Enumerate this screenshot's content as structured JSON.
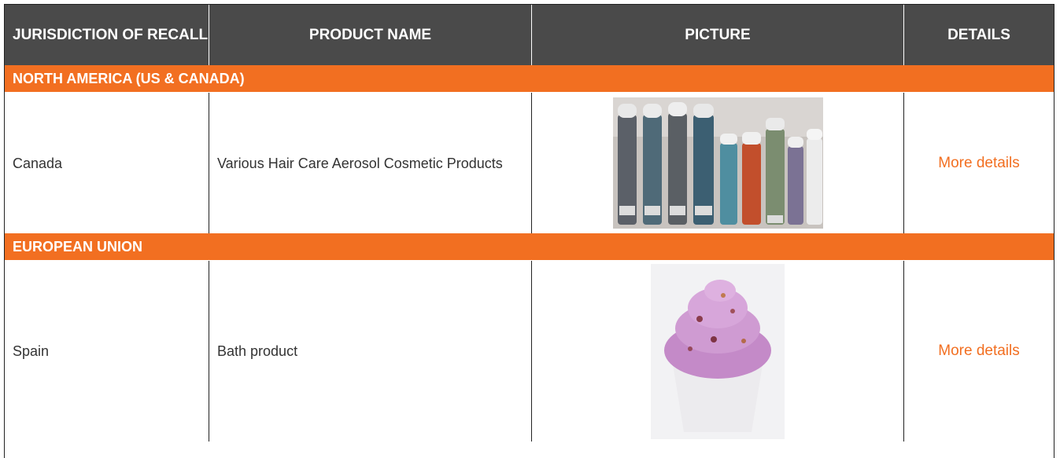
{
  "header": {
    "col1": "JURISDICTION OF RECALL",
    "col2": "PRODUCT NAME",
    "col3": "PICTURE",
    "col4": "DETAILS"
  },
  "sections": [
    {
      "title": "NORTH AMERICA (US & CANADA)",
      "row": {
        "jurisdiction": "Canada",
        "product": "Various Hair Care Aerosol Cosmetic Products",
        "details_link": "More details"
      }
    },
    {
      "title": "EUROPEAN UNION",
      "row": {
        "jurisdiction": "Spain",
        "product": "Bath product",
        "details_link": "More details"
      }
    }
  ],
  "colors": {
    "header_bg": "#4a4a4a",
    "section_bg": "#f26f21",
    "link": "#f26f21"
  }
}
